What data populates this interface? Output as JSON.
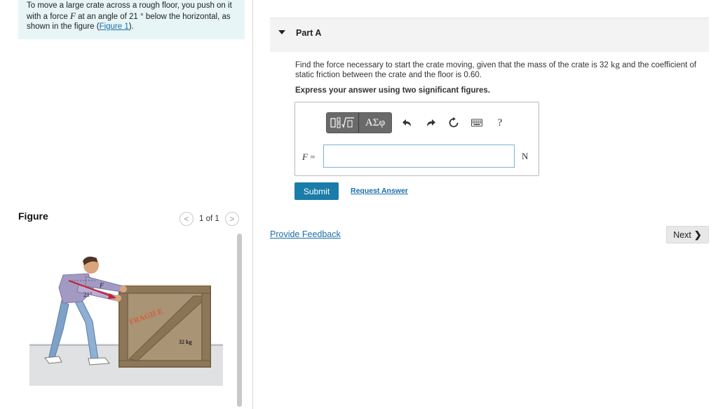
{
  "problem": {
    "text_1": "To move a large crate across a rough floor, you push on it with a force ",
    "var_F": "F",
    "text_2": " at an angle of 21 ° below the horizontal, as shown in the figure (",
    "figure_link": "Figure 1",
    "text_3": ")."
  },
  "figure": {
    "label": "Figure",
    "counter": "1 of 1",
    "prev_glyph": "<",
    "next_glyph": ">",
    "angle_label": "21°",
    "force_label": "F",
    "crate_text": "FRAGILE",
    "mass_label": "32 kg"
  },
  "part": {
    "title": "Part A",
    "question_1": "Find the force necessary to start the crate moving, given that the mass of the crate is 32 ",
    "question_unit": "kg",
    "question_2": " and the coefficient of static friction between the crate and the floor is 0.60.",
    "instruction": "Express your answer using two significant figures."
  },
  "toolbar": {
    "greek_label": "ΑΣφ",
    "help_label": "?"
  },
  "answer": {
    "var": "F",
    "equals": " =",
    "value": "",
    "unit": "N"
  },
  "actions": {
    "submit_label": "Submit",
    "request_label": "Request Answer",
    "feedback_label": "Provide Feedback",
    "next_label": "Next"
  },
  "colors": {
    "accent": "#1a7ca8",
    "link": "#1a6fa8",
    "problem_bg": "#e7f5f6"
  }
}
